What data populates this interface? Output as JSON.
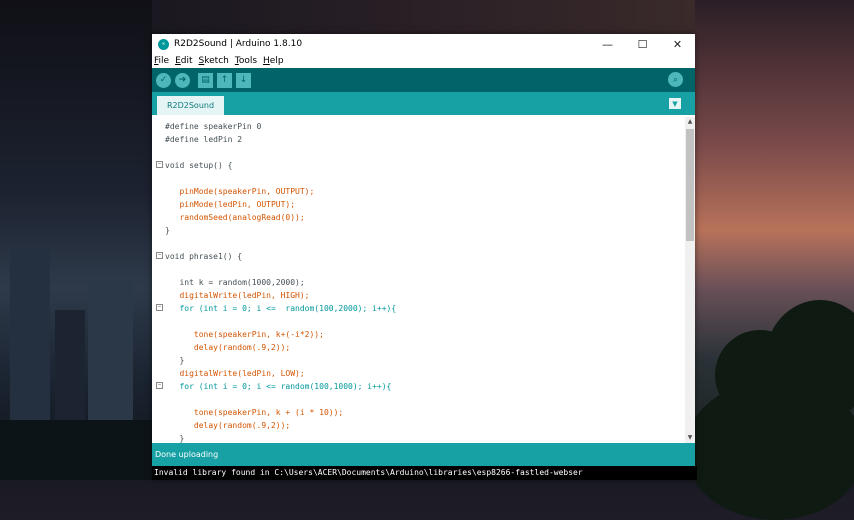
{
  "window": {
    "title": "R2D2Sound | Arduino 1.8.10",
    "minimize": "—",
    "maximize": "☐",
    "close": "✕"
  },
  "menu": [
    "File",
    "Edit",
    "Sketch",
    "Tools",
    "Help"
  ],
  "toolbar": {
    "verify": "✓",
    "upload": "➜",
    "new": "▤",
    "open": "↑",
    "save": "↓",
    "serial_monitor": "⌕"
  },
  "tab": {
    "name": "R2D2Sound",
    "menu": "▼"
  },
  "code_lines": [
    "#define speakerPin 0",
    "#define ledPin 2",
    "",
    "void setup() {",
    "",
    "   pinMode(speakerPin, OUTPUT);",
    "   pinMode(ledPin, OUTPUT);",
    "   randomSeed(analogRead(0));",
    "}",
    "",
    "void phrase1() {",
    "",
    "   int k = random(1000,2000);",
    "   digitalWrite(ledPin, HIGH);",
    "   for (int i = 0; i <=  random(100,2000); i++){",
    "",
    "      tone(speakerPin, k+(-i*2));",
    "      delay(random(.9,2));",
    "   }",
    "   digitalWrite(ledPin, LOW);",
    "   for (int i = 0; i <= random(100,1000); i++){",
    "",
    "      tone(speakerPin, k + (i * 10));",
    "      delay(random(.9,2));",
    "   }"
  ],
  "status": "Done uploading",
  "console": "Invalid library found in C:\\Users\\ACER\\Documents\\Arduino\\libraries\\esp8266-fastled-webser"
}
